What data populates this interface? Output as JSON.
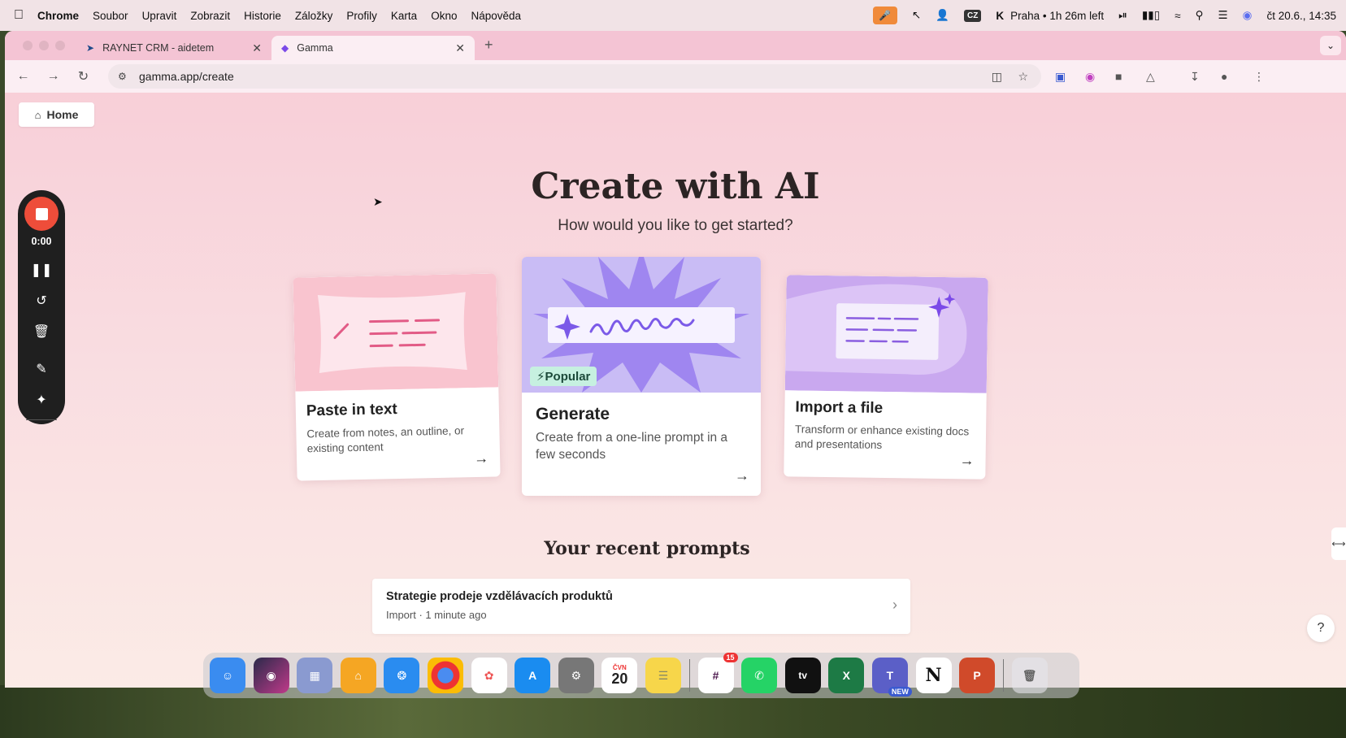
{
  "menubar": {
    "app": "Chrome",
    "items": [
      "Soubor",
      "Upravit",
      "Zobrazit",
      "Historie",
      "Záložky",
      "Profily",
      "Karta",
      "Okno",
      "Nápověda"
    ],
    "input_source": "CZ",
    "timer_status": "Praha • 1h 26m left",
    "datetime": "čt 20.6., 14:35"
  },
  "tabs": [
    {
      "title": "RAYNET CRM - aidetem",
      "active": false
    },
    {
      "title": "Gamma",
      "active": true
    }
  ],
  "address_bar": {
    "url": "gamma.app/create"
  },
  "page": {
    "home_label": "Home",
    "title": "Create with AI",
    "subtitle": "How would you like to get started?",
    "cards": [
      {
        "title": "Paste in text",
        "description": "Create from notes, an outline, or existing content"
      },
      {
        "title": "Generate",
        "description": "Create from a one-line prompt in a few seconds",
        "badge": "Popular"
      },
      {
        "title": "Import a file",
        "description": "Transform or enhance existing docs and presentations"
      }
    ],
    "recent_heading": "Your recent prompts",
    "recent": [
      {
        "title": "Strategie prodeje vzdělávacích produktů",
        "meta": "Import · 1 minute ago"
      }
    ],
    "help_label": "?"
  },
  "recorder": {
    "elapsed": "0:00"
  },
  "dock": {
    "calendar_month": "ČVN",
    "calendar_day": "20",
    "slack_badge": "15",
    "teams_badge": "NEW"
  },
  "colors": {
    "accent_purple": "#8b6cf0",
    "stop_red": "#ee4d3a",
    "popular_bg": "#c6f0e0"
  }
}
